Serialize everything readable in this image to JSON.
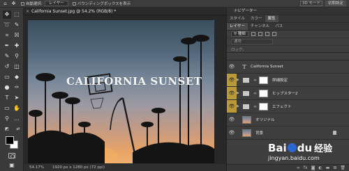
{
  "options_bar": {
    "home_icon": "home-icon",
    "auto_select_label": "自動選択:",
    "auto_select_value": "レイヤー",
    "bounding_box_label": "バウンディングボックスを表示",
    "mode_3d_label": "3D モード",
    "workspace_value": "初期設定"
  },
  "document": {
    "tab_title": "California Sunset.jpg @ 54.2% (RGB/8) *",
    "photo_text": "CALIFORNIA SUNSET",
    "status_zoom": "54.17%",
    "status_info": "1920 px x 1280 px (72 ppi)"
  },
  "tools": [
    {
      "name": "move-tool",
      "glyph": "✥"
    },
    {
      "name": "marquee-tool",
      "glyph": "⬚"
    },
    {
      "name": "lasso-tool",
      "glyph": "➰"
    },
    {
      "name": "quick-select-tool",
      "glyph": "✎"
    },
    {
      "name": "crop-tool",
      "glyph": "⌗"
    },
    {
      "name": "frame-tool",
      "glyph": "☒"
    },
    {
      "name": "eyedropper-tool",
      "glyph": "✒"
    },
    {
      "name": "healing-tool",
      "glyph": "✚"
    },
    {
      "name": "brush-tool",
      "glyph": "✎"
    },
    {
      "name": "stamp-tool",
      "glyph": "⚲"
    },
    {
      "name": "history-brush-tool",
      "glyph": "↺"
    },
    {
      "name": "eraser-tool",
      "glyph": "◫"
    },
    {
      "name": "gradient-tool",
      "glyph": "▭"
    },
    {
      "name": "blur-tool",
      "glyph": "💧"
    },
    {
      "name": "dodge-tool",
      "glyph": "●"
    },
    {
      "name": "pen-tool",
      "glyph": "✑"
    },
    {
      "name": "type-tool",
      "glyph": "T"
    },
    {
      "name": "path-select-tool",
      "glyph": "➤"
    },
    {
      "name": "shape-tool",
      "glyph": "▭"
    },
    {
      "name": "hand-tool",
      "glyph": "✋"
    },
    {
      "name": "zoom-tool",
      "glyph": "⚲"
    },
    {
      "name": "edit-toolbar-tool",
      "glyph": "…"
    }
  ],
  "colors": {
    "foreground": "#000000",
    "background": "#ffffff",
    "selection_highlight": "#b99a3a"
  },
  "panels": {
    "navigator_label": "ナビゲーター",
    "top_tabs": [
      "スタイル",
      "カラー",
      "属性"
    ],
    "layer_tabs": [
      "レイヤー",
      "チャンネル",
      "パス"
    ],
    "filter_label": "種類",
    "blend_mode": "通常",
    "lock_label": "ロック:"
  },
  "layers": [
    {
      "name": "California Sunset",
      "kind": "type",
      "selected": false,
      "locked": false
    },
    {
      "name": "詳細設定",
      "kind": "group",
      "selected": true,
      "locked": false
    },
    {
      "name": "ヒップスター2",
      "kind": "group",
      "selected": true,
      "locked": false
    },
    {
      "name": "エフェクト",
      "kind": "group",
      "selected": true,
      "locked": false
    },
    {
      "name": "オリジナル",
      "kind": "image",
      "selected": false,
      "locked": false
    },
    {
      "name": "背景",
      "kind": "image",
      "selected": false,
      "locked": true
    }
  ],
  "watermark": {
    "brand": "Bai",
    "paw": "du",
    "chinese": "经验",
    "url": "jingyan.baidu.com"
  }
}
